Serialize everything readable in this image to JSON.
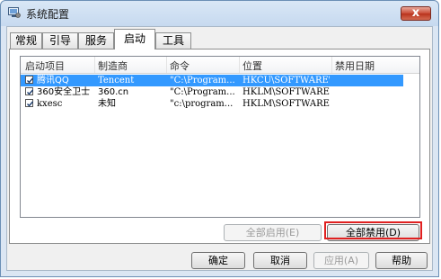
{
  "window": {
    "title": "系统配置",
    "close_label": "x"
  },
  "tabs": [
    {
      "label": "常规"
    },
    {
      "label": "引导"
    },
    {
      "label": "服务"
    },
    {
      "label": "启动"
    },
    {
      "label": "工具"
    }
  ],
  "active_tab": "启动",
  "columns": [
    "启动项目",
    "制造商",
    "命令",
    "位置",
    "禁用日期"
  ],
  "rows": [
    {
      "checked": true,
      "name": "腾讯QQ",
      "maker": "Tencent",
      "command": "\"C:\\Program...",
      "location": "HKCU\\SOFTWARE\\M...",
      "date": "",
      "selected": true
    },
    {
      "checked": true,
      "name": "360安全卫士",
      "maker": "360.cn",
      "command": "\"C:\\Program...",
      "location": "HKLM\\SOFTWARE\\W...",
      "date": "",
      "selected": false
    },
    {
      "checked": true,
      "name": "kxesc",
      "maker": "未知",
      "command": "\"c:\\program...",
      "location": "HKLM\\SOFTWARE\\W...",
      "date": "",
      "selected": false
    }
  ],
  "buttons": {
    "enable_all": "全部启用(E)",
    "disable_all": "全部禁用(D)",
    "ok": "确定",
    "cancel": "取消",
    "apply": "应用(A)",
    "help": "帮助"
  },
  "colors": {
    "selection": "#3399ff",
    "highlight_border": "#e02020"
  }
}
